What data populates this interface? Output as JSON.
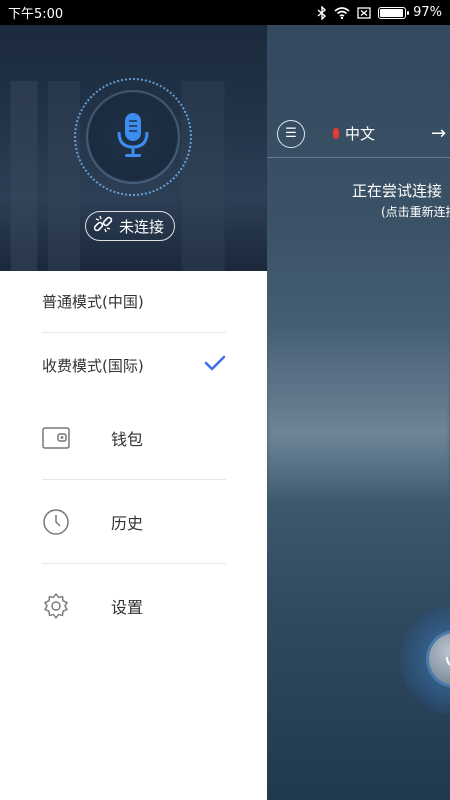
{
  "status_bar": {
    "time": "下午5:00",
    "battery_percent": "97%",
    "battery_level": 0.97
  },
  "drawer": {
    "connection_status": "未连接",
    "modes": [
      {
        "label": "普通模式(中国)",
        "selected": false
      },
      {
        "label": "收费模式(国际)",
        "selected": true
      }
    ],
    "menu": [
      {
        "label": "钱包",
        "icon": "wallet-icon"
      },
      {
        "label": "历史",
        "icon": "clock-icon"
      },
      {
        "label": "设置",
        "icon": "gear-icon"
      }
    ]
  },
  "main": {
    "source_language": "中文",
    "connecting_text": "正在尝试连接",
    "reconnect_hint": "(点击重新连接)",
    "mic_color": "#3d8df0",
    "check_color": "#3d6df0"
  }
}
